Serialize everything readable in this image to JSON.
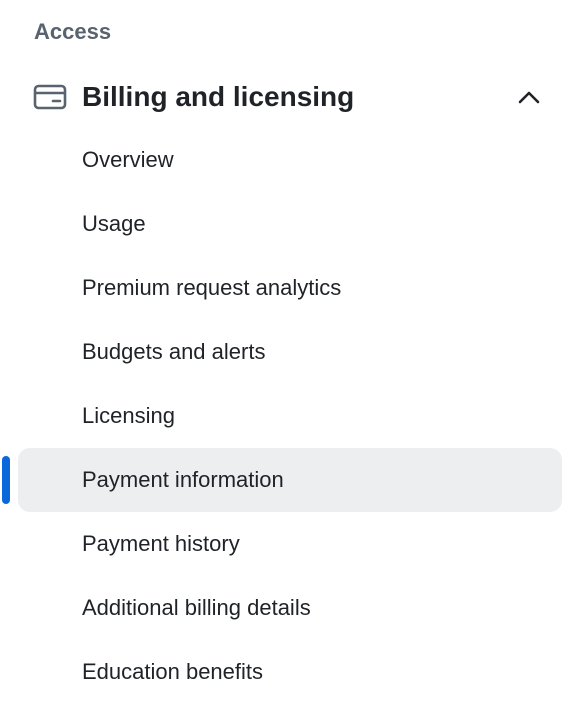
{
  "section": {
    "heading": "Access"
  },
  "group": {
    "title": "Billing and licensing",
    "icon": "credit-card-icon",
    "expanded": true,
    "toggle_icon": "chevron-up-icon"
  },
  "items": [
    {
      "label": "Overview",
      "active": false
    },
    {
      "label": "Usage",
      "active": false
    },
    {
      "label": "Premium request analytics",
      "active": false
    },
    {
      "label": "Budgets and alerts",
      "active": false
    },
    {
      "label": "Licensing",
      "active": false
    },
    {
      "label": "Payment information",
      "active": true
    },
    {
      "label": "Payment history",
      "active": false
    },
    {
      "label": "Additional billing details",
      "active": false
    },
    {
      "label": "Education benefits",
      "active": false
    }
  ],
  "colors": {
    "accent": "#0969da",
    "active_background": "#eceef0",
    "heading_text": "#59636e",
    "text": "#1f2328"
  }
}
